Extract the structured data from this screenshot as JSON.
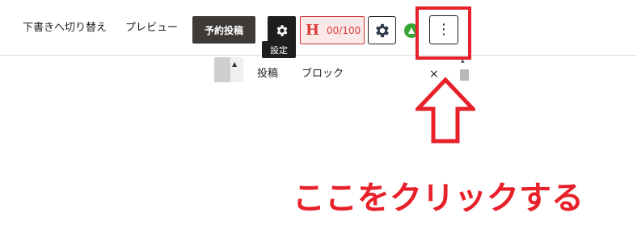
{
  "toolbar": {
    "switch_to_draft": "下書きへ切り替え",
    "preview": "プレビュー",
    "schedule_button": "予約投稿",
    "settings_tooltip": "設定",
    "seo": {
      "letter": "H",
      "count": "00/100"
    }
  },
  "sidebar": {
    "tabs": [
      {
        "label": "投稿"
      },
      {
        "label": "ブロック"
      }
    ],
    "close_symbol": "×"
  },
  "more_menu": {
    "symbol": "⋮"
  },
  "annotation": {
    "text": "ここをクリックする",
    "color": "#e8202a"
  },
  "icons": {
    "settings": "gear-icon",
    "plugin": "plugin-gear-icon",
    "green": "green-circle-icon",
    "more": "more-vertical-icon",
    "arrow": "up-arrow-icon"
  }
}
